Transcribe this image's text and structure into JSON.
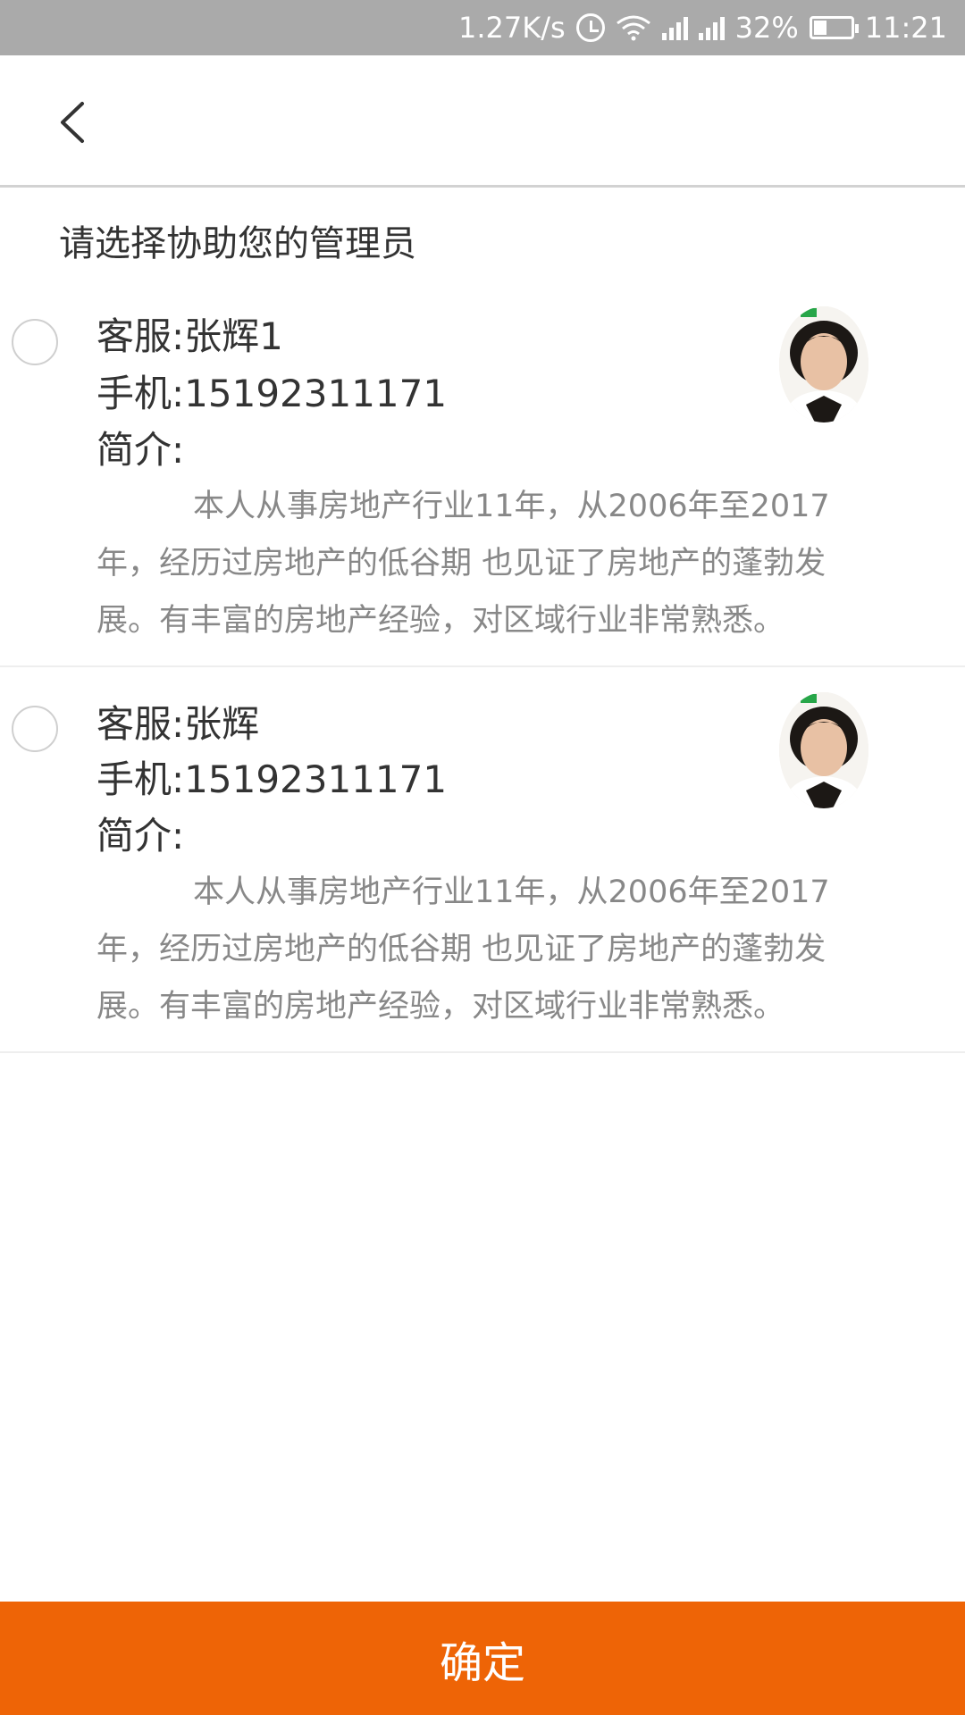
{
  "status_bar": {
    "net_speed": "1.27K/s",
    "battery": "32%",
    "time": "11:21",
    "icons": [
      "alarm-icon",
      "wifi-icon",
      "signal-icon",
      "signal-icon",
      "battery-icon"
    ]
  },
  "header": {
    "back_icon": "chevron-left-icon"
  },
  "prompt": "请选择协助您的管理员",
  "managers": [
    {
      "name": "客服:张辉1",
      "phone": "手机:15192311171",
      "intro_label": "简介:",
      "description": "本人从事房地产行业11年，从2006年至2017年，经历过房地产的低谷期 也见证了房地产的蓬勃发展。有丰富的房地产经验，对区域行业非常熟悉。",
      "selected": false
    },
    {
      "name": "客服:张辉",
      "phone": "手机:15192311171",
      "intro_label": "简介:",
      "description": "本人从事房地产行业11年，从2006年至2017年，经历过房地产的低谷期 也见证了房地产的蓬勃发展。有丰富的房地产经验，对区域行业非常熟悉。",
      "selected": false
    }
  ],
  "confirm_label": "确定",
  "colors": {
    "accent": "#ee6406",
    "status_bar": "#aaaaaa",
    "text_primary": "#333333",
    "text_secondary": "#888888"
  }
}
